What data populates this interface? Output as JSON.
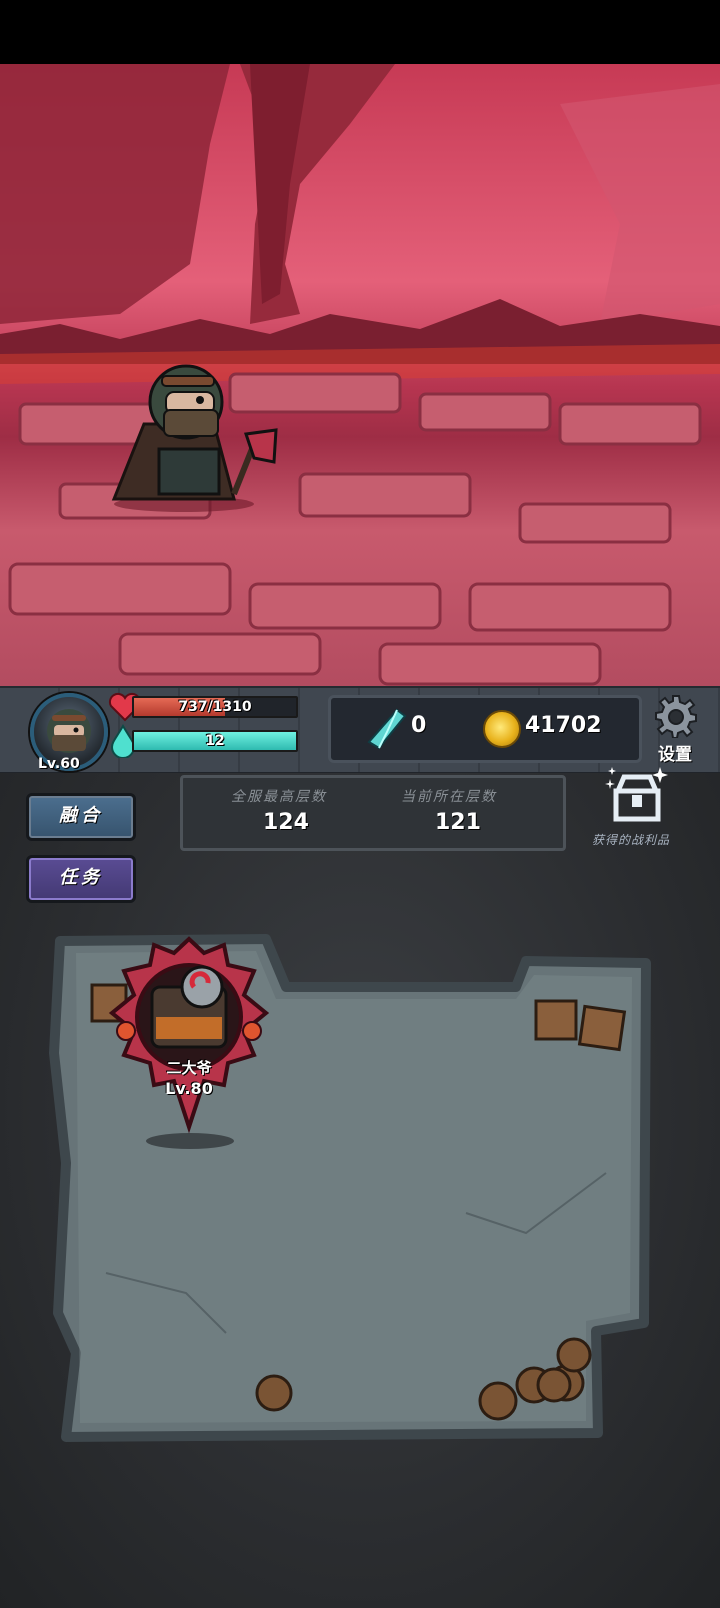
{
  "hud": {
    "player_level": "Lv.60",
    "hp_text": "737/1310",
    "hp_fraction": 0.563,
    "mp_text": "12",
    "mp_fraction": 1.0,
    "gems": "0",
    "coins": "41702",
    "settings_label": "设置"
  },
  "sidebar": {
    "fuse_label": "融合",
    "task_label": "任务"
  },
  "floors": {
    "best_label": "全服最高层数",
    "best_value": "124",
    "current_label": "当前所在层数",
    "current_value": "121"
  },
  "loot": {
    "label": "获得的战利品"
  },
  "enemy": {
    "name": "二大爷",
    "level": "Lv.80"
  },
  "colors": {
    "sky_red": "#e46079",
    "hp_red": "#c84a3a",
    "mp_teal": "#3fd0c4",
    "coin_gold": "#e8b21c",
    "badge_red": "#b8344a"
  }
}
